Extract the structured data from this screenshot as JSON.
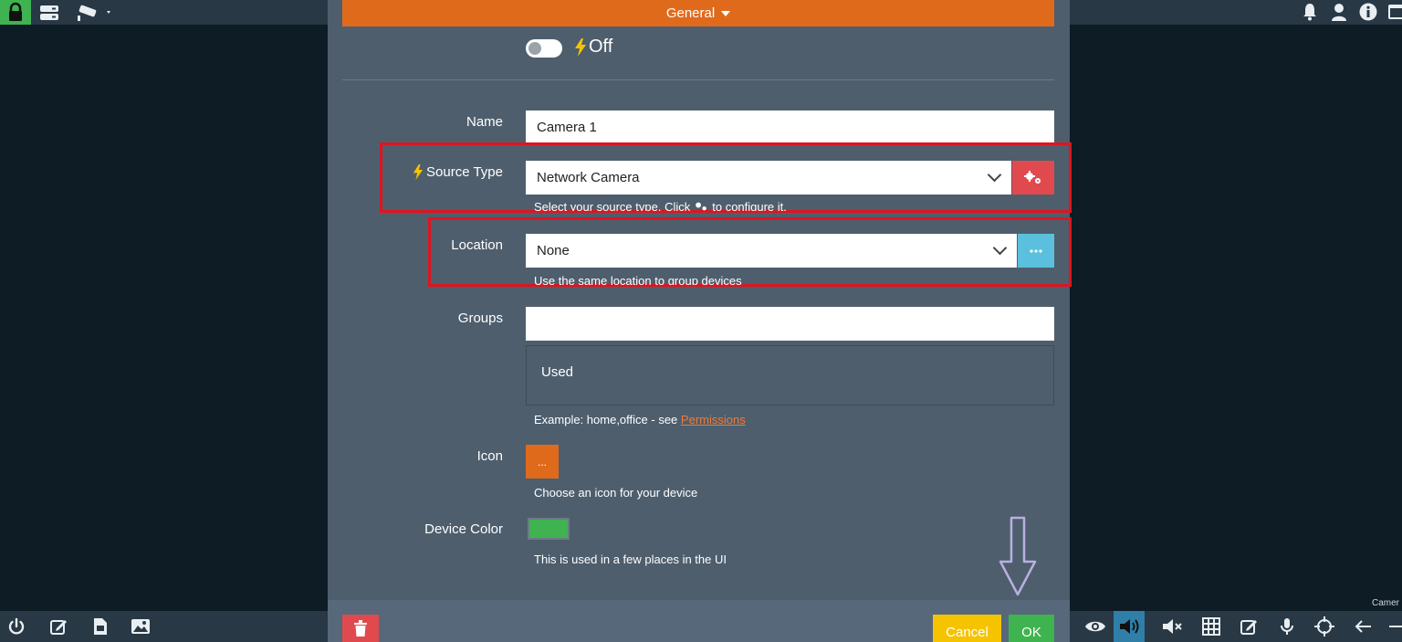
{
  "modal": {
    "header_title": "General",
    "toggle_label": "Off",
    "fields": {
      "name_label": "Name",
      "name_value": "Camera 1",
      "source_type_label": "Source Type",
      "source_type_value": "Network Camera",
      "source_type_help": "Select your source type. Click",
      "source_type_help_suffix": "to configure it.",
      "location_label": "Location",
      "location_value": "None",
      "location_help": "Use the same location to group devices",
      "groups_label": "Groups",
      "groups_value": "",
      "groups_used": "Used",
      "groups_help": "Example: home,office - see",
      "groups_help_link": "Permissions",
      "icon_label": "Icon",
      "icon_button": "...",
      "icon_help": "Choose an icon for your device",
      "color_label": "Device Color",
      "color_value": "#3fb34f",
      "color_help": "This is used in a few places in the UI"
    },
    "footer": {
      "cancel_label": "Cancel",
      "ok_label": "OK"
    }
  },
  "corner_text": "Camer",
  "colors": {
    "accent_orange": "#e06a1c",
    "danger_red": "#e04a4f",
    "info_blue": "#5bc0de",
    "success_green": "#3fb34f",
    "warning_yellow": "#f5c300",
    "highlight_red": "#e0141f"
  },
  "icons": {
    "top_left": [
      "lock-icon",
      "server-icon",
      "cctv-camera-icon"
    ],
    "top_right": [
      "bell-icon",
      "user-icon",
      "info-icon",
      "window-icon"
    ],
    "bottom_left": [
      "power-icon",
      "edit-icon",
      "file-icon",
      "image-icon"
    ],
    "bottom_right": [
      "eye-icon",
      "volume-icon",
      "mute-icon",
      "grid-icon",
      "edit-icon",
      "microphone-icon",
      "crosshair-icon",
      "arrow-left-icon",
      "minus-icon"
    ]
  }
}
